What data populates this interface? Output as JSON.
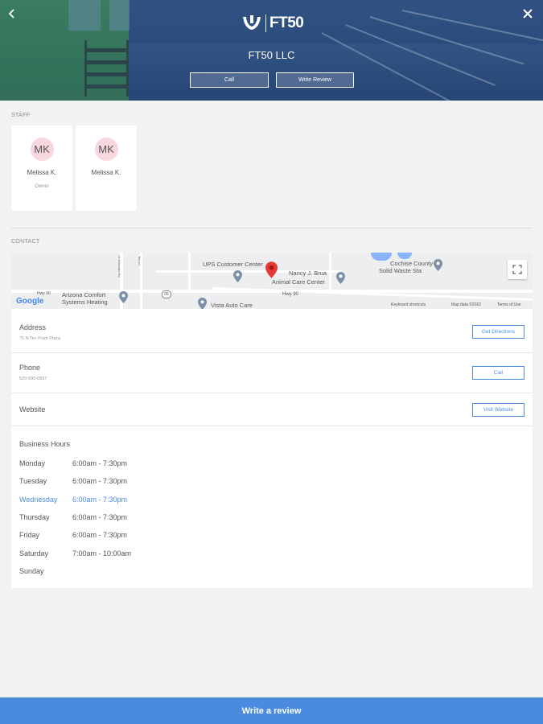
{
  "header": {
    "logo_text": "FT50",
    "business_name": "FT50 LLC",
    "call_label": "Call",
    "write_review_label": "Write Review"
  },
  "staff": {
    "section_label": "STAFF",
    "members": [
      {
        "initials": "MK",
        "name": "Melissa K.",
        "role": "Owner"
      },
      {
        "initials": "MK",
        "name": "Melissa K.",
        "role": ""
      }
    ]
  },
  "contact": {
    "section_label": "CONTACT",
    "map": {
      "labels": {
        "ups": "UPS Customer Center",
        "nancy": "Nancy J. Brua",
        "animal": "Animal Care Center",
        "cochise1": "Cochise County",
        "cochise2": "Solid Waste Sta",
        "arizona1": "Arizona Comfort",
        "arizona2": "Systems Heating",
        "vista": "Vista Auto Care",
        "hwy1": "Hwy 90",
        "hwy2": "Hwy 90",
        "highway_shield": "90",
        "google": "Google",
        "keyboard": "Keyboard shortcuts",
        "mapdata": "Map data ©2022",
        "terms": "Terms of Use"
      }
    },
    "address": {
      "title": "Address",
      "value": "75 N Tev Point Plaza",
      "button": "Get Directions"
    },
    "phone": {
      "title": "Phone",
      "value": "520-590-0837",
      "button": "Call"
    },
    "website": {
      "title": "Website",
      "button": "Visit Website"
    },
    "hours": {
      "title": "Business Hours",
      "days": [
        {
          "day": "Monday",
          "time": "6:00am - 7:30pm"
        },
        {
          "day": "Tuesday",
          "time": "6:00am - 7:30pm"
        },
        {
          "day": "Wednesday",
          "time": "6:00am - 7:30pm"
        },
        {
          "day": "Thursday",
          "time": "6:00am - 7:30pm"
        },
        {
          "day": "Friday",
          "time": "6:00am - 7:30pm"
        },
        {
          "day": "Saturday",
          "time": "7:00am - 10:00am"
        },
        {
          "day": "Sunday",
          "time": ""
        }
      ]
    }
  },
  "footer": {
    "write_review_label": "Write a review"
  },
  "colors": {
    "accent": "#4a8be0",
    "avatar_bg": "#f8d7df",
    "pin": "#e53935"
  }
}
